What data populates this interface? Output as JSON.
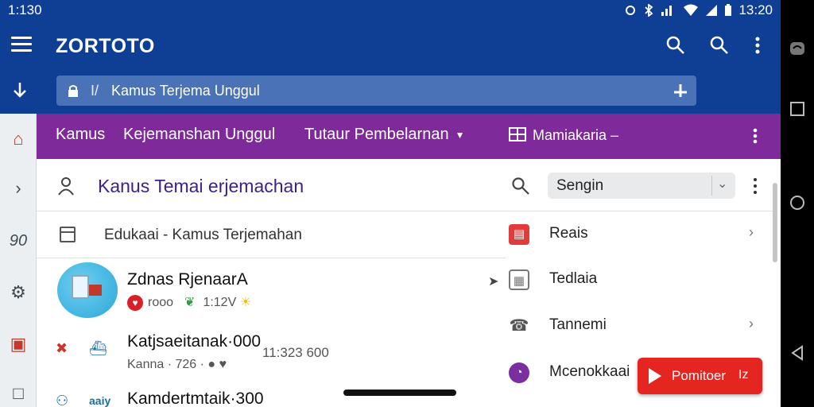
{
  "status_bar": {
    "time_left": "1:130",
    "time_right": "13:20"
  },
  "app_bar": {
    "title": "ZORTOTO",
    "icons": [
      "menu-icon",
      "search-icon",
      "search-icon",
      "more-vert-icon"
    ]
  },
  "url_bar": {
    "separator": "I/",
    "text": "Kamus Terjema Unggul"
  },
  "tabs": [
    {
      "label": "Kamus"
    },
    {
      "label": "Kejemanshan Unggul"
    },
    {
      "label": "Tutaur Pembelarnan",
      "has_caret": true
    },
    {
      "label": "Mamiakaria –",
      "icon": "grid-icon"
    }
  ],
  "rail": {
    "items": [
      "home-icon",
      "chevron-right-icon",
      "history-icon",
      "settings-icon",
      "bookmark-icon",
      "square-icon"
    ],
    "history_label": "90"
  },
  "main": {
    "headline": "Kanus Temai erjemachan",
    "search": {
      "value": "Sengin"
    },
    "subrow": "Edukaai - Kamus Terjemahan",
    "items": [
      {
        "title": "Zdnas RjenaarA",
        "meta_prefix": "rooo",
        "meta_suffix": "1:12V"
      },
      {
        "title": "Katjsaeitanak·000",
        "meta": "Kanna · 726 ·",
        "time": "11:323 600"
      },
      {
        "title": "Kamdertmtaik·300",
        "meta": "",
        "time": ""
      }
    ],
    "item_icon_text": "aaiy"
  },
  "right_panel": {
    "items": [
      {
        "label": "Reais",
        "icon": "book-icon",
        "color": "#e23b3b",
        "chevron": true
      },
      {
        "label": "Tedlaia",
        "icon": "table-icon",
        "color": "#777777",
        "chevron": false
      },
      {
        "label": "Tannemi",
        "icon": "phone-icon",
        "color": "#555555",
        "chevron": true
      },
      {
        "label": "Mcenokkaai",
        "icon": "clock-icon",
        "color": "#7b2ea0",
        "chevron": false
      }
    ]
  },
  "fab": {
    "label": "Pomitoer",
    "ext": "Iz"
  },
  "colors": {
    "top_blue": "#0f3f94",
    "tab_purple": "#7f2a9a",
    "fab_red": "#e52520"
  }
}
